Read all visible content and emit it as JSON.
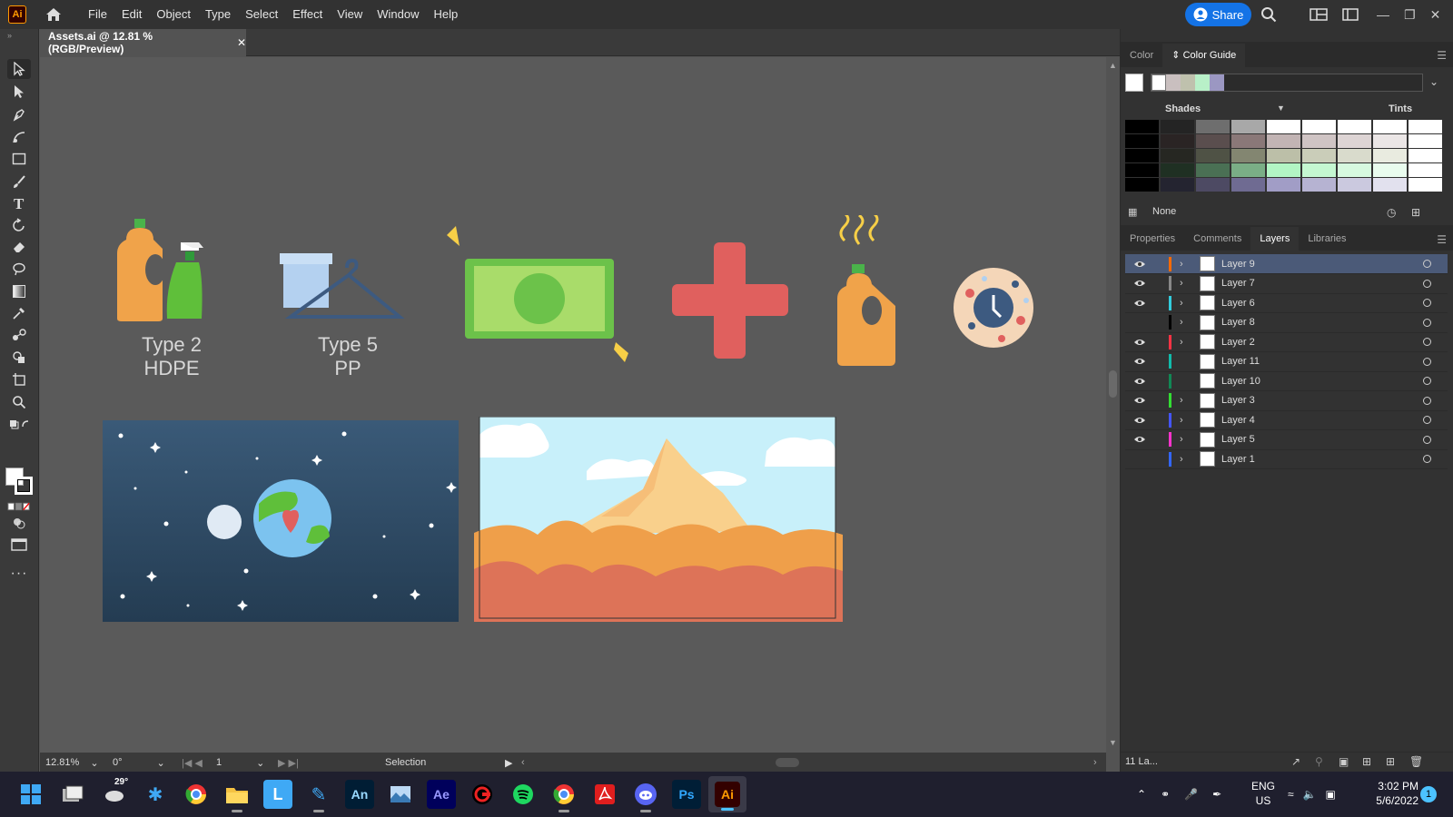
{
  "app": {
    "logo_text": "Ai"
  },
  "menu": [
    "File",
    "Edit",
    "Object",
    "Type",
    "Select",
    "Effect",
    "View",
    "Window",
    "Help"
  ],
  "share_label": "Share",
  "document_tab": {
    "title": "Assets.ai @ 12.81 % (RGB/Preview)",
    "close": "✕"
  },
  "canvas": {
    "label_type2": "Type 2",
    "label_hdpe": "HDPE",
    "label_type5": "Type 5",
    "label_pp": "PP"
  },
  "status": {
    "zoom": "12.81%",
    "rotation": "0°",
    "artboard": "1",
    "tool": "Selection"
  },
  "color_panel": {
    "tabs": [
      "Color",
      "Color Guide"
    ],
    "shades_label": "Shades",
    "tints_label": "Tints",
    "none_label": "None"
  },
  "layers_panel": {
    "tabs": [
      "Properties",
      "Comments",
      "Layers",
      "Libraries"
    ],
    "footer_count": "11 La...",
    "layers": [
      {
        "name": "Layer 9",
        "color": "#ff6a00",
        "visible": true,
        "expandable": true,
        "selected": true
      },
      {
        "name": "Layer 7",
        "color": "#888888",
        "visible": true,
        "expandable": true,
        "selected": false
      },
      {
        "name": "Layer 6",
        "color": "#33ccdd",
        "visible": true,
        "expandable": true,
        "selected": false
      },
      {
        "name": "Layer 8",
        "color": "#000000",
        "visible": false,
        "expandable": true,
        "selected": false
      },
      {
        "name": "Layer 2",
        "color": "#ff3344",
        "visible": true,
        "expandable": true,
        "selected": false
      },
      {
        "name": "Layer 11",
        "color": "#11bbaa",
        "visible": true,
        "expandable": false,
        "selected": false
      },
      {
        "name": "Layer 10",
        "color": "#118855",
        "visible": true,
        "expandable": false,
        "selected": false
      },
      {
        "name": "Layer 3",
        "color": "#33dd33",
        "visible": true,
        "expandable": true,
        "selected": false
      },
      {
        "name": "Layer 4",
        "color": "#4455ff",
        "visible": true,
        "expandable": true,
        "selected": false
      },
      {
        "name": "Layer 5",
        "color": "#ff33cc",
        "visible": true,
        "expandable": true,
        "selected": false
      },
      {
        "name": "Layer 1",
        "color": "#3366ff",
        "visible": false,
        "expandable": true,
        "selected": false
      }
    ]
  },
  "taskbar": {
    "weather": "29°",
    "lang": "ENG",
    "region": "US",
    "time": "3:02 PM",
    "date": "5/6/2022",
    "notif": "1",
    "apps": [
      "start",
      "task-view",
      "weather",
      "copilot",
      "chrome",
      "file-explorer",
      "l-app",
      "pen",
      "animate",
      "photos",
      "after-effects",
      "game",
      "spotify",
      "chrome-profile",
      "acrobat",
      "discord",
      "photoshop",
      "illustrator"
    ],
    "an": "An",
    "ae": "Ae",
    "ps": "Ps",
    "ai": "Ai",
    "l": "L"
  }
}
